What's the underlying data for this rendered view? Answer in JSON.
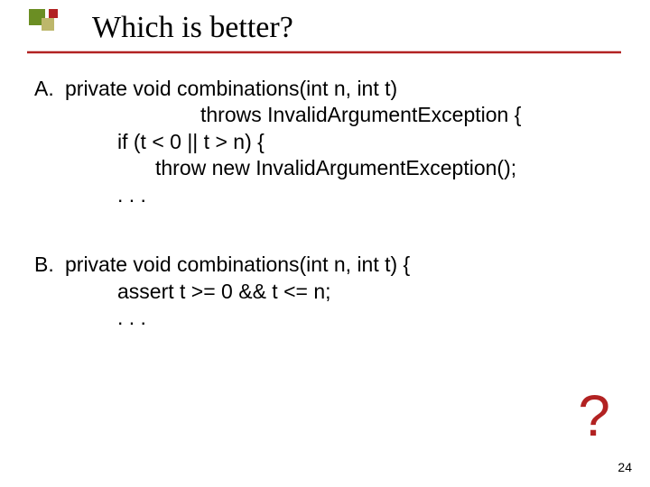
{
  "title": "Which is better?",
  "options": [
    {
      "label": "A.",
      "lines": [
        "private void combinations(int n, int t)",
        "throws InvalidArgumentException {",
        "if (t < 0 || t > n) {",
        "throw new InvalidArgumentException();",
        ". . ."
      ]
    },
    {
      "label": "B.",
      "lines": [
        "private void combinations(int n, int t) {",
        "assert t >= 0 && t <= n;",
        ". . ."
      ]
    }
  ],
  "mark": "?",
  "page_number": "24",
  "colors": {
    "accent_red": "#B22222",
    "accent_olive": "#BDB76B",
    "accent_green": "#6B8E23"
  }
}
